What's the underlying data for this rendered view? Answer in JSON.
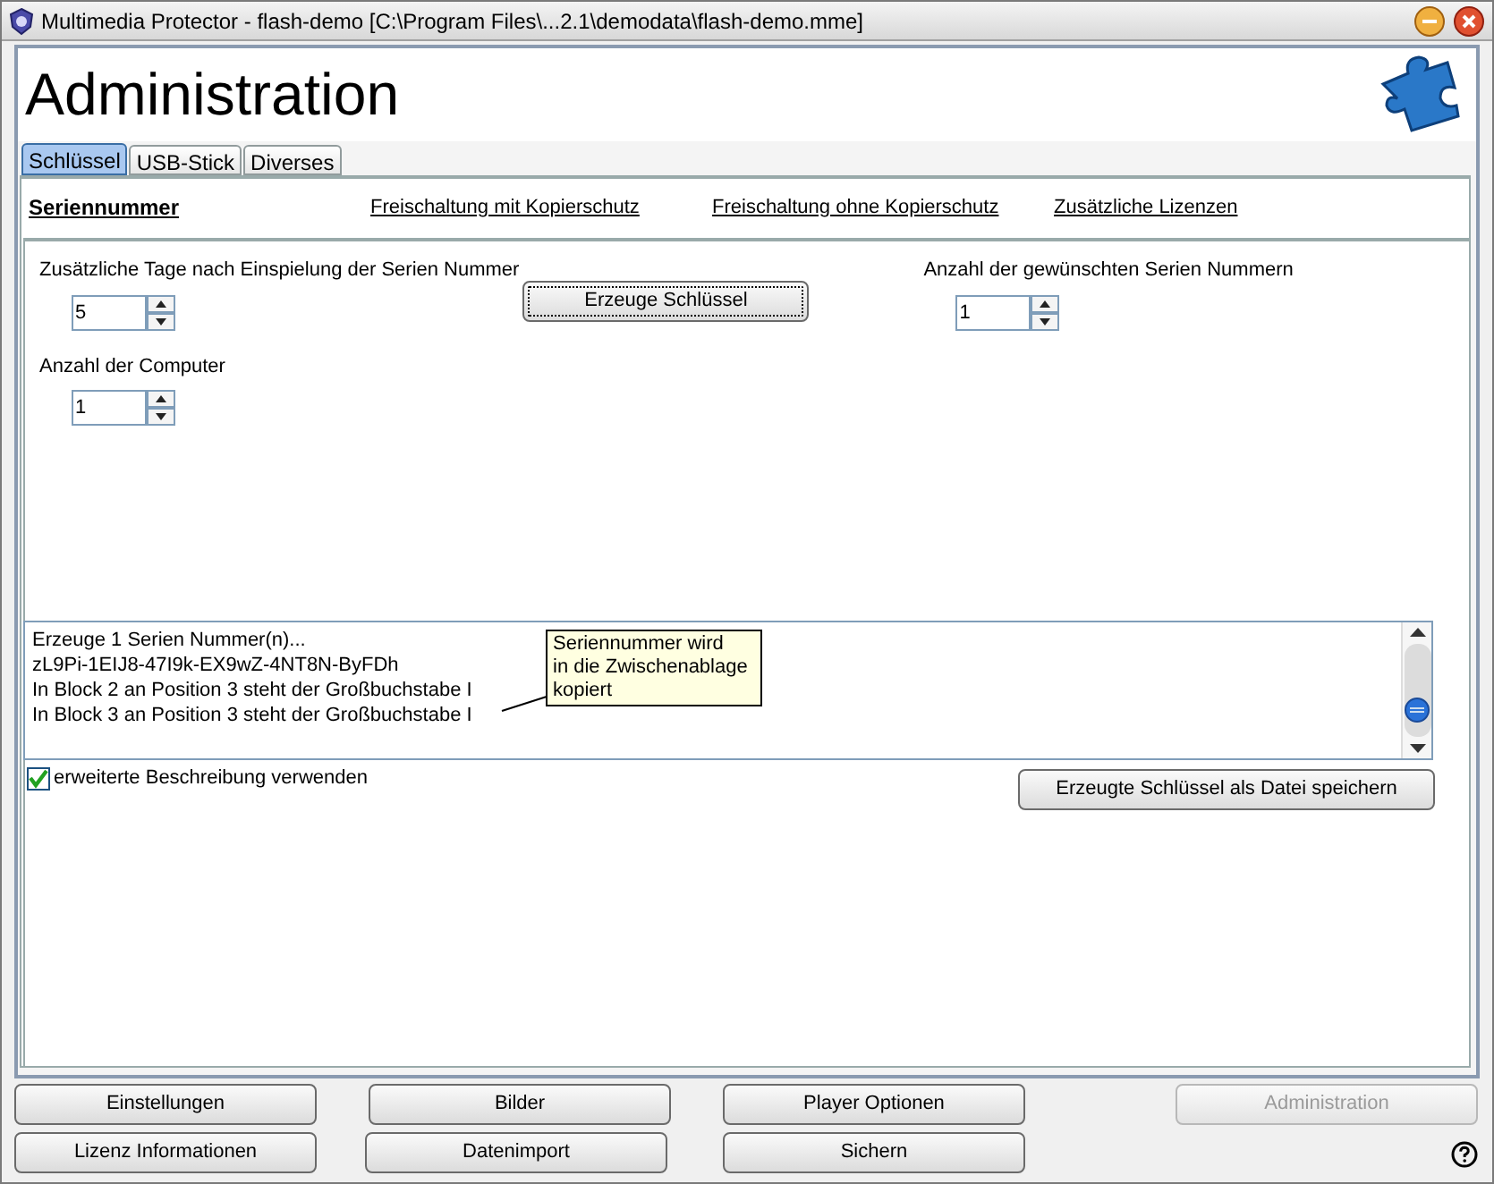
{
  "window": {
    "title": "Multimedia Protector - flash-demo [C:\\Program Files\\...2.1\\demodata\\flash-demo.mme]"
  },
  "header": {
    "title": "Administration"
  },
  "tabs": [
    {
      "label": "Schlüssel",
      "selected": true
    },
    {
      "label": "USB-Stick",
      "selected": false
    },
    {
      "label": "Diverses",
      "selected": false
    }
  ],
  "subtabs": [
    {
      "label": "Seriennummer",
      "selected": true
    },
    {
      "label": "Freischaltung mit Kopierschutz",
      "selected": false
    },
    {
      "label": "Freischaltung ohne Kopierschutz",
      "selected": false
    },
    {
      "label": "Zusätzliche Lizenzen",
      "selected": false
    }
  ],
  "form": {
    "days": {
      "label": "Zusätzliche Tage nach Einspielung der Serien Nummer",
      "value": "5"
    },
    "generate_button": "Erzeuge Schlüssel",
    "count": {
      "label": "Anzahl der gewünschten Serien Nummern",
      "value": "1"
    },
    "computers": {
      "label": "Anzahl der Computer",
      "value": "1"
    }
  },
  "log": {
    "lines": [
      "Erzeuge 1 Serien Nummer(n)...",
      "zL9Pi-1EIJ8-47I9k-EX9wZ-4NT8N-ByFDh",
      "In Block 2 an Position 3 steht der Großbuchstabe I",
      "In Block 3 an Position 3 steht der Großbuchstabe I"
    ],
    "tooltip": [
      "Seriennummer wird",
      "in die Zwischenablage",
      "kopiert"
    ]
  },
  "extended_description": {
    "label": "erweiterte Beschreibung verwenden",
    "checked": true
  },
  "save_button": "Erzeugte Schlüssel als Datei speichern",
  "footer_rows": [
    [
      {
        "label": "Einstellungen",
        "disabled": false
      },
      {
        "label": "Bilder",
        "disabled": false
      },
      {
        "label": "Player Optionen",
        "disabled": false
      },
      {
        "label": "Administration",
        "disabled": true
      }
    ],
    [
      {
        "label": "Lizenz Informationen",
        "disabled": false
      },
      {
        "label": "Datenimport",
        "disabled": false
      },
      {
        "label": "Sichern",
        "disabled": false
      }
    ]
  ]
}
